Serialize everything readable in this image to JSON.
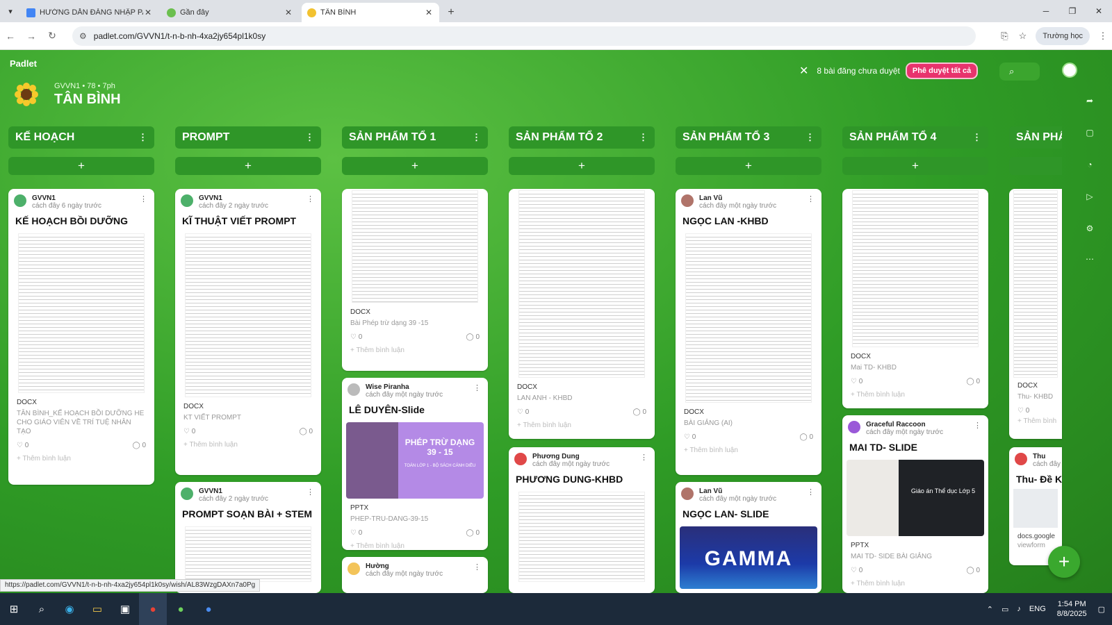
{
  "browser": {
    "tabs": [
      {
        "title": "HƯỚNG DẪN ĐĂNG NHẬP PAD",
        "color": "#4285f4"
      },
      {
        "title": "Gần đây",
        "color": "#6bbf4e"
      },
      {
        "title": "TÂN BÌNH",
        "color": "#f2c230"
      }
    ],
    "url": "padlet.com/GVVN1/t-n-b-nh-4xa2jy654pl1k0sy",
    "profile": "Trường học"
  },
  "padlet": {
    "brand": "Padlet",
    "subtitle": "GVVN1 • 78 • 7ph",
    "title": "TÂN BÌNH",
    "pending_text": "8 bài đăng chưa duyệt",
    "approve_label": "Phê duyệt tất cả"
  },
  "columns": [
    {
      "title": "KẾ HOẠCH"
    },
    {
      "title": "PROMPT"
    },
    {
      "title": "SẢN PHẨM TỔ 1"
    },
    {
      "title": "SẢN PHẨM TỔ 2"
    },
    {
      "title": "SẢN PHẨM TỔ 3"
    },
    {
      "title": "SẢN PHẨM TỔ 4"
    },
    {
      "title": "SẢN PHẨ"
    }
  ],
  "cards": [
    {
      "author": "GVVN1",
      "time": "cách đây 6 ngày trước",
      "title": "KẾ HOẠCH BỒI DƯỠNG",
      "badge": "DOCX",
      "caption": "TÂN BÌNH_KẾ HOẠCH BỒI DƯỠNG HE CHO GIÁO VIÊN VỀ TRÍ TUỆ NHÂN TẠO",
      "likes": "0",
      "comments": "0",
      "comment_label": "Thêm bình luận"
    },
    {
      "author": "GVVN1",
      "time": "cách đây 2 ngày trước",
      "title": "KĨ THUẬT VIẾT PROMPT",
      "badge": "DOCX",
      "caption": "KT VIẾT PROMPT",
      "likes": "0",
      "comments": "0",
      "comment_label": "Thêm bình luận"
    },
    {
      "author": "GVVN1",
      "time": "cách đây 2 ngày trước",
      "title": "PROMPT SOẠN BÀI + STEM"
    },
    {
      "badge": "DOCX",
      "caption": "Bài Phép trừ dạng 39 -15",
      "likes": "0",
      "comments": "0",
      "comment_label": "Thêm bình luận"
    },
    {
      "author": "Wise Piranha",
      "time": "cách đây một ngày trước",
      "title": "LÊ DUYÊN-Slide",
      "badge": "PPTX",
      "caption": "PHEP-TRU-DANG-39-15",
      "likes": "0",
      "comments": "0",
      "comment_label": "Thêm bình luận",
      "thumb_text": "PHÉP TRỪ DẠNG 39 - 15",
      "thumb_sub": "TOÁN LỚP 1 - BỘ SÁCH CÁNH DIỀU"
    },
    {
      "author": "Hường",
      "time": "cách đây một ngày trước"
    },
    {
      "badge": "DOCX",
      "caption": "LAN ANH - KHBD",
      "likes": "0",
      "comments": "0",
      "comment_label": "Thêm bình luận"
    },
    {
      "author": "Phương Dung",
      "time": "cách đây một ngày trước",
      "title": "PHƯƠNG DUNG-KHBD"
    },
    {
      "author": "Lan Vũ",
      "time": "cách đây một ngày trước",
      "title": "NGỌC LAN -KHBD",
      "badge": "DOCX",
      "caption": "BÀI GIẢNG (AI)",
      "likes": "0",
      "comments": "0",
      "comment_label": "Thêm bình luận"
    },
    {
      "author": "Lan Vũ",
      "time": "cách đây một ngày trước",
      "title": "NGỌC LAN- SLIDE",
      "thumb_text": "GAMMA"
    },
    {
      "badge": "DOCX",
      "caption": "Mai TD- KHBD",
      "likes": "0",
      "comments": "0",
      "comment_label": "Thêm bình luận"
    },
    {
      "author": "Graceful Raccoon",
      "time": "cách đây một ngày trước",
      "title": "MAI TD- SLIDE",
      "badge": "PPTX",
      "caption": "MAI TD- SIDE BÀI GIẢNG",
      "likes": "0",
      "comments": "0",
      "comment_label": "Thêm bình luận",
      "thumb_text": "Giáo án Thể dục Lớp 5"
    },
    {
      "badge": "DOCX",
      "caption": "Thu- KHBD",
      "likes": "0",
      "comment_label": "Thêm bình"
    },
    {
      "author": "Thu",
      "time": "cách đây",
      "title": "Thu- Đề K",
      "caption": "docs.google",
      "caption2": "viewform"
    }
  ],
  "status_url": "https://padlet.com/GVVN1/t-n-b-nh-4xa2jy654pl1k0sy/wish/AL83WzgDAXn7a0Pg",
  "taskbar": {
    "lang": "ENG",
    "time": "1:54 PM",
    "date": "8/8/2025"
  }
}
